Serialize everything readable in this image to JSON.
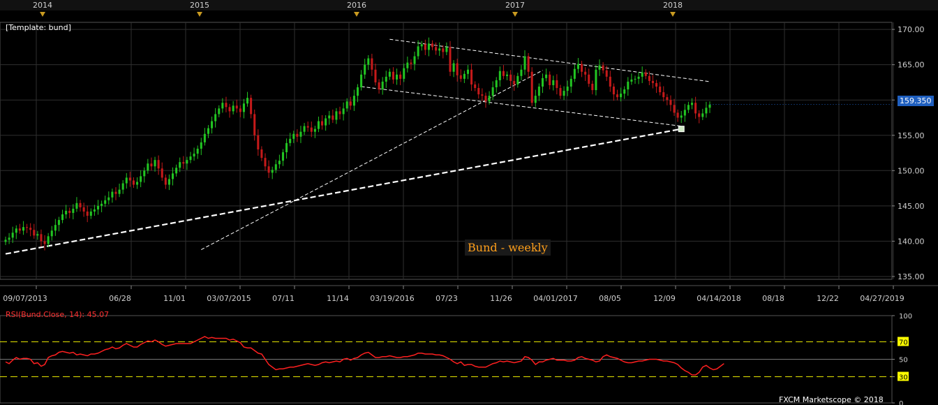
{
  "header": {
    "years": [
      "2014",
      "2015",
      "2016",
      "2017",
      "2018"
    ]
  },
  "template_label": "[Template: bund]",
  "watermark": "Bund - weekly",
  "price_badge": "159.350",
  "copyright": "FXCM Marketscope © 2018",
  "x_axis_labels": [
    "09/07/2013",
    "06/28",
    "11/01",
    "03/07/2015",
    "07/11",
    "11/14",
    "03/19/2016",
    "07/23",
    "11/26",
    "04/01/2017",
    "08/05",
    "12/09",
    "04/14/2018",
    "08/18",
    "12/22",
    "04/27/2019"
  ],
  "colors": {
    "up": "#22c522",
    "down": "#c51a1a",
    "rsi": "#ff2020",
    "background": "#000000",
    "grid": "#2f2f2f",
    "text": "#d0d0d0",
    "level_line": "#e6e600",
    "level_box": "#ffff00"
  },
  "chart_data": [
    {
      "type": "candlestick",
      "title": "",
      "period": "weekly",
      "y_axis": {
        "ticks": [
          "135.00",
          "140.00",
          "145.00",
          "150.00",
          "155.00",
          "160.00",
          "165.00",
          "170.00"
        ],
        "ylim": [
          134.6,
          171.0
        ]
      },
      "grid": true,
      "last_price": 159.35,
      "closes": [
        140.2,
        140.5,
        141.2,
        141.8,
        141.5,
        142.0,
        141.9,
        141.6,
        140.8,
        141.0,
        140.0,
        139.6,
        140.7,
        141.5,
        142.3,
        143.0,
        143.8,
        144.3,
        144.0,
        144.6,
        145.4,
        144.8,
        144.2,
        143.6,
        144.2,
        144.5,
        145.0,
        145.3,
        145.8,
        146.2,
        147.0,
        146.7,
        147.3,
        148.2,
        149.0,
        148.6,
        148.0,
        148.4,
        149.2,
        150.0,
        151.0,
        150.6,
        151.5,
        150.3,
        149.0,
        148.0,
        148.8,
        149.6,
        150.4,
        151.2,
        151.0,
        151.5,
        152.0,
        152.4,
        153.1,
        154.0,
        155.2,
        156.0,
        157.0,
        158.0,
        158.8,
        159.6,
        159.0,
        158.4,
        159.2,
        158.8,
        158.3,
        159.5,
        160.3,
        158.0,
        155.0,
        153.0,
        151.8,
        150.6,
        149.7,
        150.1,
        150.9,
        151.4,
        152.6,
        153.9,
        154.5,
        155.2,
        154.8,
        155.5,
        156.3,
        156.1,
        155.5,
        155.9,
        157.0,
        156.4,
        157.4,
        157.8,
        157.2,
        158.4,
        158.0,
        158.8,
        159.8,
        159.2,
        160.6,
        161.8,
        163.6,
        165.0,
        165.9,
        164.3,
        162.5,
        161.5,
        162.6,
        163.3,
        164.0,
        162.9,
        163.6,
        163.0,
        164.5,
        165.3,
        165.1,
        166.2,
        167.6,
        167.9,
        167.1,
        168.0,
        167.5,
        167.0,
        167.3,
        166.8,
        167.5,
        164.0,
        165.2,
        163.5,
        163.0,
        163.7,
        164.3,
        162.2,
        161.7,
        160.8,
        160.6,
        159.8,
        160.6,
        161.8,
        162.8,
        164.1,
        163.4,
        163.6,
        162.7,
        162.2,
        163.4,
        164.3,
        166.2,
        164.0,
        159.6,
        160.6,
        161.9,
        163.1,
        163.6,
        162.1,
        162.8,
        161.7,
        160.6,
        161.3,
        161.9,
        163.0,
        164.4,
        165.1,
        164.0,
        163.6,
        162.3,
        161.4,
        164.3,
        164.9,
        164.2,
        163.3,
        161.9,
        160.8,
        160.4,
        160.9,
        161.5,
        162.6,
        162.9,
        163.0,
        163.3,
        163.9,
        163.4,
        162.7,
        162.4,
        161.9,
        161.1,
        160.4,
        160.0,
        159.3,
        158.2,
        157.5,
        157.8,
        158.6,
        159.3,
        159.6,
        158.1,
        157.6,
        158.1,
        158.9,
        159.35
      ]
    },
    {
      "type": "line",
      "title": "RSI(Bund.Close, 14): 45.07",
      "indicator": "RSI",
      "period": 14,
      "current_value": 45.07,
      "y_axis": {
        "ticks": [
          "0",
          "30",
          "50",
          "70",
          "100"
        ],
        "ylim": [
          0,
          100
        ]
      },
      "levels": [
        30,
        70
      ],
      "values": [
        47,
        45,
        49,
        52,
        50,
        51,
        51,
        50,
        45,
        46,
        42,
        44,
        52,
        54,
        55,
        58,
        59,
        58,
        57,
        58,
        55,
        56,
        55,
        54,
        56,
        56,
        57,
        59,
        61,
        62,
        64,
        62,
        63,
        66,
        68,
        66,
        64,
        64,
        67,
        69,
        71,
        70,
        72,
        70,
        67,
        65,
        66,
        67,
        68,
        68,
        68,
        68,
        68,
        70,
        72,
        74,
        76,
        74,
        75,
        74,
        74,
        74,
        74,
        72,
        73,
        71,
        69,
        64,
        63,
        63,
        60,
        57,
        56,
        50,
        44,
        41,
        38,
        39,
        39,
        40,
        41,
        41,
        42,
        43,
        44,
        45,
        44,
        43,
        44,
        46,
        47,
        46,
        47,
        48,
        47,
        50,
        51,
        49,
        51,
        52,
        55,
        57,
        58,
        55,
        52,
        52,
        53,
        53,
        54,
        53,
        52,
        52,
        53,
        53,
        54,
        55,
        57,
        57,
        56,
        56,
        56,
        55,
        55,
        54,
        52,
        50,
        47,
        45,
        47,
        43,
        44,
        44,
        42,
        41,
        41,
        41,
        43,
        45,
        46,
        48,
        47,
        48,
        47,
        46,
        47,
        48,
        53,
        52,
        49,
        44,
        47,
        47,
        49,
        50,
        51,
        49,
        49,
        49,
        48,
        48,
        49,
        52,
        53,
        51,
        50,
        49,
        47,
        48,
        53,
        55,
        53,
        52,
        51,
        49,
        47,
        46,
        46,
        47,
        48,
        48,
        49,
        50,
        50,
        50,
        49,
        48,
        48,
        47,
        46,
        44,
        40,
        37,
        35,
        32,
        32,
        35,
        41,
        43,
        40,
        38,
        39,
        42,
        45.07
      ]
    }
  ]
}
